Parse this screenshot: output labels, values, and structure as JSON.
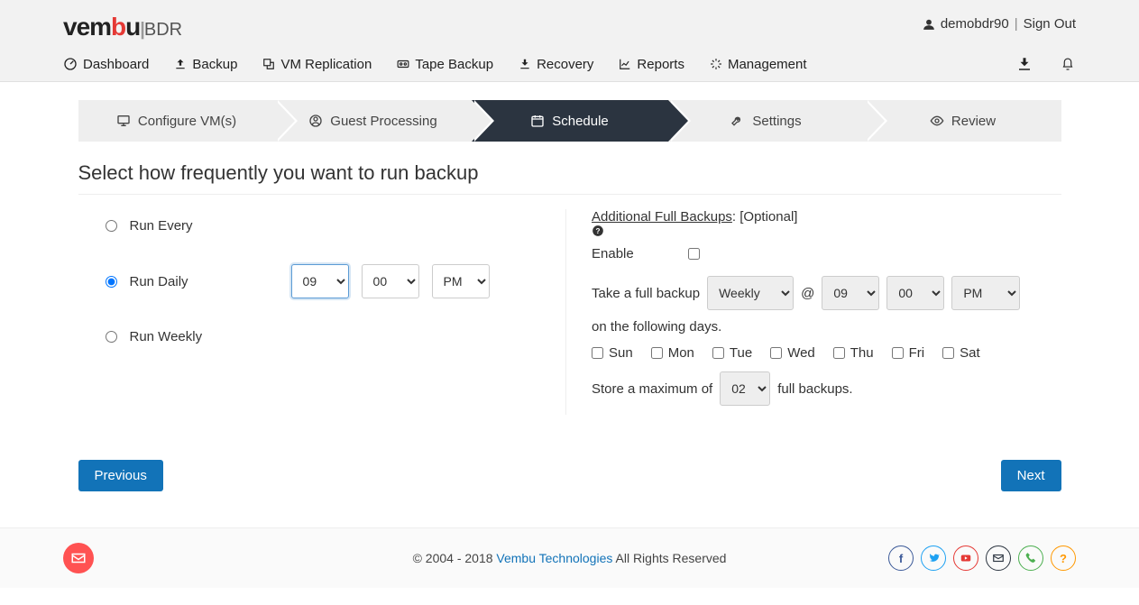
{
  "logo": {
    "pre": "vem",
    "red": "b",
    "post": "u",
    "bar": "|",
    "suffix": "BDR"
  },
  "user": {
    "name": "demobdr90",
    "signout": "Sign Out"
  },
  "nav": {
    "dashboard": "Dashboard",
    "backup": "Backup",
    "vmrep": "VM Replication",
    "tape": "Tape Backup",
    "recovery": "Recovery",
    "reports": "Reports",
    "mgmt": "Management"
  },
  "wizard": {
    "configure": "Configure VM(s)",
    "guest": "Guest Processing",
    "schedule": "Schedule",
    "settings": "Settings",
    "review": "Review"
  },
  "heading": "Select how frequently you want to run backup",
  "schedule": {
    "runEvery": "Run Every",
    "runDaily": "Run Daily",
    "runWeekly": "Run Weekly",
    "hour": "09",
    "minute": "00",
    "ampm": "PM"
  },
  "additional": {
    "title": "Additional Full Backups",
    "optional": ": [Optional]",
    "enable": "Enable",
    "takeFull": "Take a full backup",
    "period": "Weekly",
    "hour": "09",
    "minute": "00",
    "ampm": "PM",
    "at": "@",
    "onDays": "on the following days.",
    "days": {
      "sun": "Sun",
      "mon": "Mon",
      "tue": "Tue",
      "wed": "Wed",
      "thu": "Thu",
      "fri": "Fri",
      "sat": "Sat"
    },
    "storeMax1": "Store a maximum of",
    "storeMax2": "full backups.",
    "count": "02"
  },
  "actions": {
    "prev": "Previous",
    "next": "Next"
  },
  "footer": {
    "copy": "2004 - 2018",
    "company": "Vembu Technologies",
    "rights": "All Rights Reserved"
  }
}
